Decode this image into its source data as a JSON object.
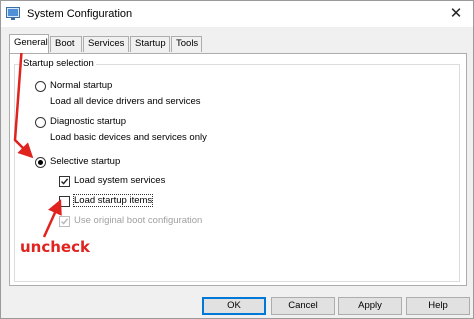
{
  "window": {
    "title": "System Configuration",
    "close_glyph": "✕"
  },
  "tabs": [
    {
      "label": "General",
      "active": true
    },
    {
      "label": "Boot",
      "active": false
    },
    {
      "label": "Services",
      "active": false
    },
    {
      "label": "Startup",
      "active": false
    },
    {
      "label": "Tools",
      "active": false
    }
  ],
  "startup_selection": {
    "label": "Startup selection",
    "normal": {
      "label": "Normal startup",
      "description": "Load all device drivers and services",
      "selected": false
    },
    "diagnostic": {
      "label": "Diagnostic startup",
      "description": "Load basic devices and services only",
      "selected": false
    },
    "selective": {
      "label": "Selective startup",
      "selected": true
    },
    "options": [
      {
        "label": "Load system services",
        "checked": true,
        "enabled": true
      },
      {
        "label": "Load startup items",
        "checked": false,
        "enabled": true
      },
      {
        "label": "Use original boot configuration",
        "checked": true,
        "enabled": false
      }
    ]
  },
  "buttons": {
    "ok": "OK",
    "cancel": "Cancel",
    "apply": "Apply",
    "help": "Help"
  },
  "annotation": {
    "text": "uncheck",
    "color": "#e0231f"
  },
  "colors": {
    "accent": "#0078d7",
    "annotation": "#e0231f"
  }
}
